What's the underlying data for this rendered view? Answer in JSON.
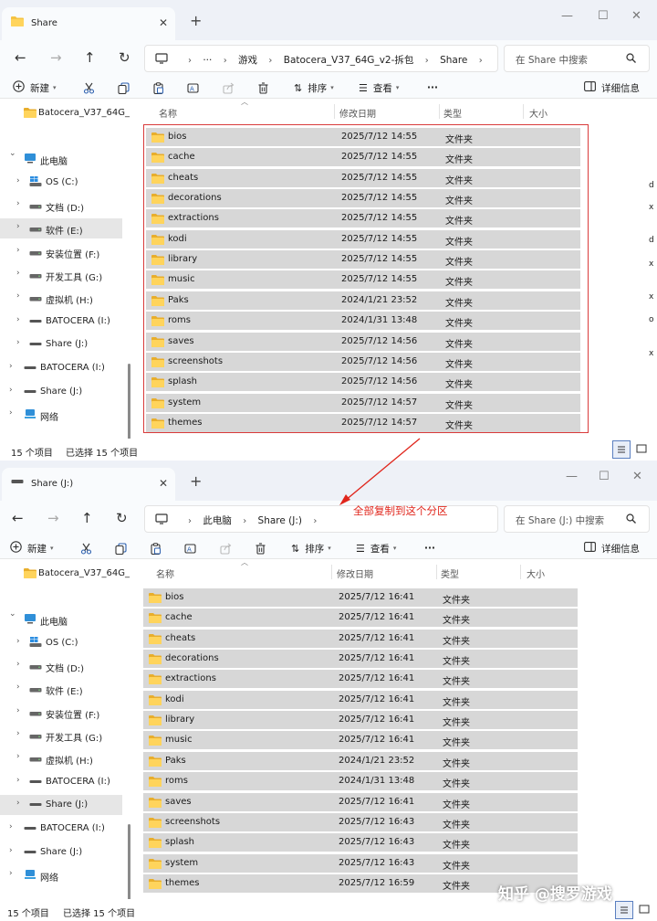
{
  "annotation_text": "全部复制到这个分区",
  "watermark_text": "知乎 @搜罗游戏",
  "edge_chars": [
    "d",
    "x",
    "",
    "d",
    "x",
    "x",
    "o",
    "x"
  ],
  "colors": {
    "accent": "#0067c0",
    "annotation": "#e0251b",
    "folder": "#f5c342",
    "row_selected": "#d7d7d7"
  },
  "window1": {
    "tab_title": "Share",
    "address": [
      "游戏",
      "Batocera_V37_64G_v2-拆包",
      "Share"
    ],
    "address_more": "···",
    "search_placeholder": "在 Share 中搜索",
    "toolbar": {
      "new": "新建",
      "sort": "排序",
      "view": "查看",
      "more": "···",
      "details": "详细信息"
    },
    "columns": {
      "name": "名称",
      "date": "修改日期",
      "type": "类型",
      "size": "大小"
    },
    "nav": [
      {
        "label": "Batocera_V37_64G_",
        "indent": 1,
        "icon": "folder"
      },
      {
        "label": "此电脑",
        "indent": 0,
        "icon": "pc",
        "expanded": true
      },
      {
        "label": "OS (C:)",
        "indent": 1,
        "icon": "os-drive"
      },
      {
        "label": "文档 (D:)",
        "indent": 1,
        "icon": "drive"
      },
      {
        "label": "软件 (E:)",
        "indent": 1,
        "icon": "drive",
        "selected": true
      },
      {
        "label": "安装位置 (F:)",
        "indent": 1,
        "icon": "drive"
      },
      {
        "label": "开发工具 (G:)",
        "indent": 1,
        "icon": "drive"
      },
      {
        "label": "虚拟机 (H:)",
        "indent": 1,
        "icon": "drive"
      },
      {
        "label": "BATOCERA (I:)",
        "indent": 1,
        "icon": "usb"
      },
      {
        "label": "Share (J:)",
        "indent": 1,
        "icon": "usb"
      },
      {
        "label": "BATOCERA (I:)",
        "indent": 0,
        "icon": "usb"
      },
      {
        "label": "Share (J:)",
        "indent": 0,
        "icon": "usb"
      },
      {
        "label": "网络",
        "indent": 0,
        "icon": "network"
      }
    ],
    "files": [
      {
        "name": "bios",
        "date": "2025/7/12 14:55",
        "type": "文件夹"
      },
      {
        "name": "cache",
        "date": "2025/7/12 14:55",
        "type": "文件夹"
      },
      {
        "name": "cheats",
        "date": "2025/7/12 14:55",
        "type": "文件夹"
      },
      {
        "name": "decorations",
        "date": "2025/7/12 14:55",
        "type": "文件夹"
      },
      {
        "name": "extractions",
        "date": "2025/7/12 14:55",
        "type": "文件夹"
      },
      {
        "name": "kodi",
        "date": "2025/7/12 14:55",
        "type": "文件夹"
      },
      {
        "name": "library",
        "date": "2025/7/12 14:55",
        "type": "文件夹"
      },
      {
        "name": "music",
        "date": "2025/7/12 14:55",
        "type": "文件夹"
      },
      {
        "name": "Paks",
        "date": "2024/1/21 23:52",
        "type": "文件夹"
      },
      {
        "name": "roms",
        "date": "2024/1/31 13:48",
        "type": "文件夹"
      },
      {
        "name": "saves",
        "date": "2025/7/12 14:56",
        "type": "文件夹"
      },
      {
        "name": "screenshots",
        "date": "2025/7/12 14:56",
        "type": "文件夹"
      },
      {
        "name": "splash",
        "date": "2025/7/12 14:56",
        "type": "文件夹"
      },
      {
        "name": "system",
        "date": "2025/7/12 14:57",
        "type": "文件夹"
      },
      {
        "name": "themes",
        "date": "2025/7/12 14:57",
        "type": "文件夹"
      }
    ],
    "status": {
      "count": "15 个项目",
      "selected": "已选择 15 个项目"
    }
  },
  "window2": {
    "tab_title": "Share (J:)",
    "address": [
      "此电脑",
      "Share (J:)"
    ],
    "search_placeholder": "在 Share (J:) 中搜索",
    "toolbar": {
      "new": "新建",
      "sort": "排序",
      "view": "查看",
      "more": "···",
      "details": "详细信息"
    },
    "columns": {
      "name": "名称",
      "date": "修改日期",
      "type": "类型",
      "size": "大小"
    },
    "nav": [
      {
        "label": "Batocera_V37_64G_",
        "indent": 1,
        "icon": "folder"
      },
      {
        "label": "此电脑",
        "indent": 0,
        "icon": "pc",
        "expanded": true
      },
      {
        "label": "OS (C:)",
        "indent": 1,
        "icon": "os-drive"
      },
      {
        "label": "文档 (D:)",
        "indent": 1,
        "icon": "drive"
      },
      {
        "label": "软件 (E:)",
        "indent": 1,
        "icon": "drive"
      },
      {
        "label": "安装位置 (F:)",
        "indent": 1,
        "icon": "drive"
      },
      {
        "label": "开发工具 (G:)",
        "indent": 1,
        "icon": "drive"
      },
      {
        "label": "虚拟机 (H:)",
        "indent": 1,
        "icon": "drive"
      },
      {
        "label": "BATOCERA (I:)",
        "indent": 1,
        "icon": "usb"
      },
      {
        "label": "Share (J:)",
        "indent": 1,
        "icon": "usb",
        "selected": true
      },
      {
        "label": "BATOCERA (I:)",
        "indent": 0,
        "icon": "usb"
      },
      {
        "label": "Share (J:)",
        "indent": 0,
        "icon": "usb"
      },
      {
        "label": "网络",
        "indent": 0,
        "icon": "network"
      }
    ],
    "files": [
      {
        "name": "bios",
        "date": "2025/7/12 16:41",
        "type": "文件夹"
      },
      {
        "name": "cache",
        "date": "2025/7/12 16:41",
        "type": "文件夹"
      },
      {
        "name": "cheats",
        "date": "2025/7/12 16:41",
        "type": "文件夹"
      },
      {
        "name": "decorations",
        "date": "2025/7/12 16:41",
        "type": "文件夹"
      },
      {
        "name": "extractions",
        "date": "2025/7/12 16:41",
        "type": "文件夹"
      },
      {
        "name": "kodi",
        "date": "2025/7/12 16:41",
        "type": "文件夹"
      },
      {
        "name": "library",
        "date": "2025/7/12 16:41",
        "type": "文件夹"
      },
      {
        "name": "music",
        "date": "2025/7/12 16:41",
        "type": "文件夹"
      },
      {
        "name": "Paks",
        "date": "2024/1/21 23:52",
        "type": "文件夹"
      },
      {
        "name": "roms",
        "date": "2024/1/31 13:48",
        "type": "文件夹"
      },
      {
        "name": "saves",
        "date": "2025/7/12 16:41",
        "type": "文件夹"
      },
      {
        "name": "screenshots",
        "date": "2025/7/12 16:43",
        "type": "文件夹"
      },
      {
        "name": "splash",
        "date": "2025/7/12 16:43",
        "type": "文件夹"
      },
      {
        "name": "system",
        "date": "2025/7/12 16:43",
        "type": "文件夹"
      },
      {
        "name": "themes",
        "date": "2025/7/12 16:59",
        "type": "文件夹"
      }
    ],
    "status": {
      "count": "15 个项目",
      "selected": "已选择 15 个项目"
    }
  }
}
